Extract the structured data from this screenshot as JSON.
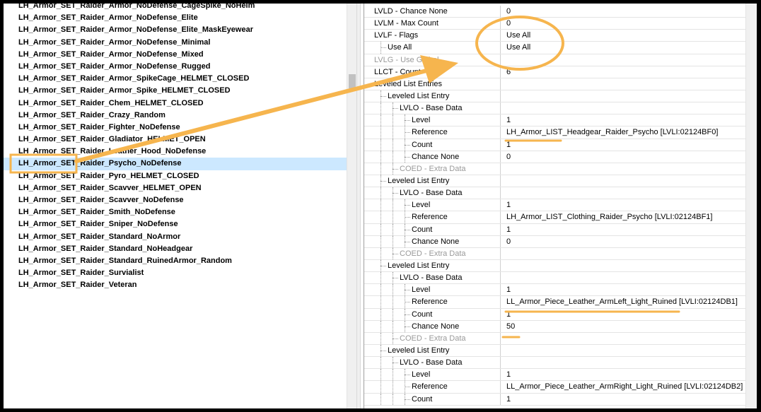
{
  "record_list": {
    "items": [
      {
        "label": "LH_Armor_SET_Raider_Armor_NoDefense_CageSpike_NoHelm"
      },
      {
        "label": "LH_Armor_SET_Raider_Armor_NoDefense_Elite"
      },
      {
        "label": "LH_Armor_SET_Raider_Armor_NoDefense_Elite_MaskEyewear"
      },
      {
        "label": "LH_Armor_SET_Raider_Armor_NoDefense_Minimal"
      },
      {
        "label": "LH_Armor_SET_Raider_Armor_NoDefense_Mixed"
      },
      {
        "label": "LH_Armor_SET_Raider_Armor_NoDefense_Rugged"
      },
      {
        "label": "LH_Armor_SET_Raider_Armor_SpikeCage_HELMET_CLOSED"
      },
      {
        "label": "LH_Armor_SET_Raider_Armor_Spike_HELMET_CLOSED"
      },
      {
        "label": "LH_Armor_SET_Raider_Chem_HELMET_CLOSED"
      },
      {
        "label": "LH_Armor_SET_Raider_Crazy_Random"
      },
      {
        "label": "LH_Armor_SET_Raider_Fighter_NoDefense"
      },
      {
        "label": "LH_Armor_SET_Raider_Gladiator_HELMET_OPEN"
      },
      {
        "label": "LH_Armor_SET_Raider_Leather_Hood_NoDefense"
      },
      {
        "label": "LH_Armor_SET_Raider_Psycho_NoDefense"
      },
      {
        "label": "LH_Armor_SET_Raider_Pyro_HELMET_CLOSED"
      },
      {
        "label": "LH_Armor_SET_Raider_Scavver_HELMET_OPEN"
      },
      {
        "label": "LH_Armor_SET_Raider_Scavver_NoDefense"
      },
      {
        "label": "LH_Armor_SET_Raider_Smith_NoDefense"
      },
      {
        "label": "LH_Armor_SET_Raider_Sniper_NoDefense"
      },
      {
        "label": "LH_Armor_SET_Raider_Standard_NoArmor"
      },
      {
        "label": "LH_Armor_SET_Raider_Standard_NoHeadgear"
      },
      {
        "label": "LH_Armor_SET_Raider_Standard_RuinedArmor_Random"
      },
      {
        "label": "LH_Armor_SET_Raider_Survialist"
      },
      {
        "label": "LH_Armor_SET_Raider_Veteran"
      }
    ],
    "selected_index": 13
  },
  "properties": {
    "rows": [
      {
        "name": "LVLD - Chance None",
        "value": "0",
        "depth": 0
      },
      {
        "name": "LVLM - Max Count",
        "value": "0",
        "depth": 0
      },
      {
        "name": "LVLF - Flags",
        "value": "Use All",
        "depth": 0
      },
      {
        "name": "Use All",
        "value": "Use All",
        "depth": 1
      },
      {
        "name": "LVLG - Use Global",
        "value": "",
        "depth": 0,
        "dim": true
      },
      {
        "name": "LLCT - Count",
        "value": "6",
        "depth": 0
      },
      {
        "name": "Leveled List Entries",
        "value": "",
        "depth": 0
      },
      {
        "name": "Leveled List Entry",
        "value": "",
        "depth": 1
      },
      {
        "name": "LVLO - Base Data",
        "value": "",
        "depth": 2
      },
      {
        "name": "Level",
        "value": "1",
        "depth": 3
      },
      {
        "name": "Reference",
        "value": "LH_Armor_LIST_Headgear_Raider_Psycho [LVLI:02124BF0]",
        "depth": 3
      },
      {
        "name": "Count",
        "value": "1",
        "depth": 3
      },
      {
        "name": "Chance None",
        "value": "0",
        "depth": 3
      },
      {
        "name": "COED - Extra Data",
        "value": "",
        "depth": 2,
        "dim": true
      },
      {
        "name": "Leveled List Entry",
        "value": "",
        "depth": 1
      },
      {
        "name": "LVLO - Base Data",
        "value": "",
        "depth": 2
      },
      {
        "name": "Level",
        "value": "1",
        "depth": 3
      },
      {
        "name": "Reference",
        "value": "LH_Armor_LIST_Clothing_Raider_Psycho [LVLI:02124BF1]",
        "depth": 3
      },
      {
        "name": "Count",
        "value": "1",
        "depth": 3
      },
      {
        "name": "Chance None",
        "value": "0",
        "depth": 3
      },
      {
        "name": "COED - Extra Data",
        "value": "",
        "depth": 2,
        "dim": true
      },
      {
        "name": "Leveled List Entry",
        "value": "",
        "depth": 1
      },
      {
        "name": "LVLO - Base Data",
        "value": "",
        "depth": 2
      },
      {
        "name": "Level",
        "value": "1",
        "depth": 3
      },
      {
        "name": "Reference",
        "value": "LL_Armor_Piece_Leather_ArmLeft_Light_Ruined [LVLI:02124DB1]",
        "depth": 3
      },
      {
        "name": "Count",
        "value": "1",
        "depth": 3
      },
      {
        "name": "Chance None",
        "value": "50",
        "depth": 3
      },
      {
        "name": "COED - Extra Data",
        "value": "",
        "depth": 2,
        "dim": true
      },
      {
        "name": "Leveled List Entry",
        "value": "",
        "depth": 1
      },
      {
        "name": "LVLO - Base Data",
        "value": "",
        "depth": 2
      },
      {
        "name": "Level",
        "value": "1",
        "depth": 3
      },
      {
        "name": "Reference",
        "value": "LL_Armor_Piece_Leather_ArmRight_Light_Ruined [LVLI:02124DB2]",
        "depth": 3
      },
      {
        "name": "Count",
        "value": "1",
        "depth": 3
      }
    ]
  },
  "annotation": {
    "color": "#f6b54e"
  }
}
